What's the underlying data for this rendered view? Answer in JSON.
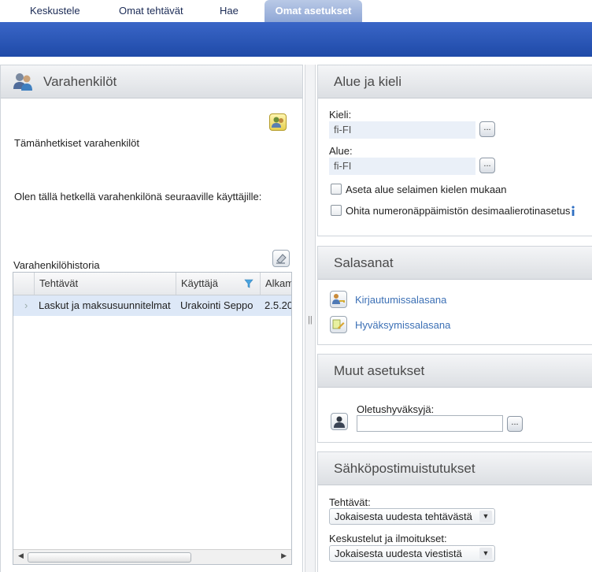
{
  "nav": {
    "tabs": [
      {
        "label": "Keskustele"
      },
      {
        "label": "Omat tehtävät"
      },
      {
        "label": "Hae"
      },
      {
        "label": "Omat asetukset"
      }
    ]
  },
  "substitutes": {
    "title": "Varahenkilöt",
    "current_label": "Tämänhetkiset varahenkilöt",
    "acting_label": "Olen tällä hetkellä varahenkilönä seuraaville käyttäjille:",
    "history_label": "Varahenkilöhistoria",
    "grid": {
      "columns": [
        "Tehtävät",
        "Käyttäjä",
        "Alkam"
      ],
      "rows": [
        {
          "tasks": "Laskut ja maksusuunnitelmat",
          "user": "Urakointi Seppo",
          "start": "2.5.20"
        }
      ]
    }
  },
  "region": {
    "title": "Alue ja kieli",
    "language_label": "Kieli:",
    "language_value": "fi-FI",
    "region_label": "Alue:",
    "region_value": "fi-FI",
    "browser_region_label": "Aseta alue selaimen kielen mukaan",
    "keypad_label": "Ohita numeronäppäimistön desimaalierotinasetus",
    "browse_label": "..."
  },
  "passwords": {
    "title": "Salasanat",
    "login_link": "Kirjautumissalasana",
    "approval_link": "Hyväksymissalasana"
  },
  "other": {
    "title": "Muut asetukset",
    "default_approver_label": "Oletushyväksyjä:",
    "default_approver_value": "",
    "browse_label": "..."
  },
  "email": {
    "title": "Sähköpostimuistutukset",
    "tasks_label": "Tehtävät:",
    "tasks_value": "Jokaisesta uudesta tehtävästä",
    "discussions_label": "Keskustelut ja ilmoitukset:",
    "discussions_value": "Jokaisesta uudesta viestistä"
  },
  "colors": {
    "banner": "#2a57b8",
    "link": "#3c70b5",
    "selected_row": "#dde8f7"
  }
}
